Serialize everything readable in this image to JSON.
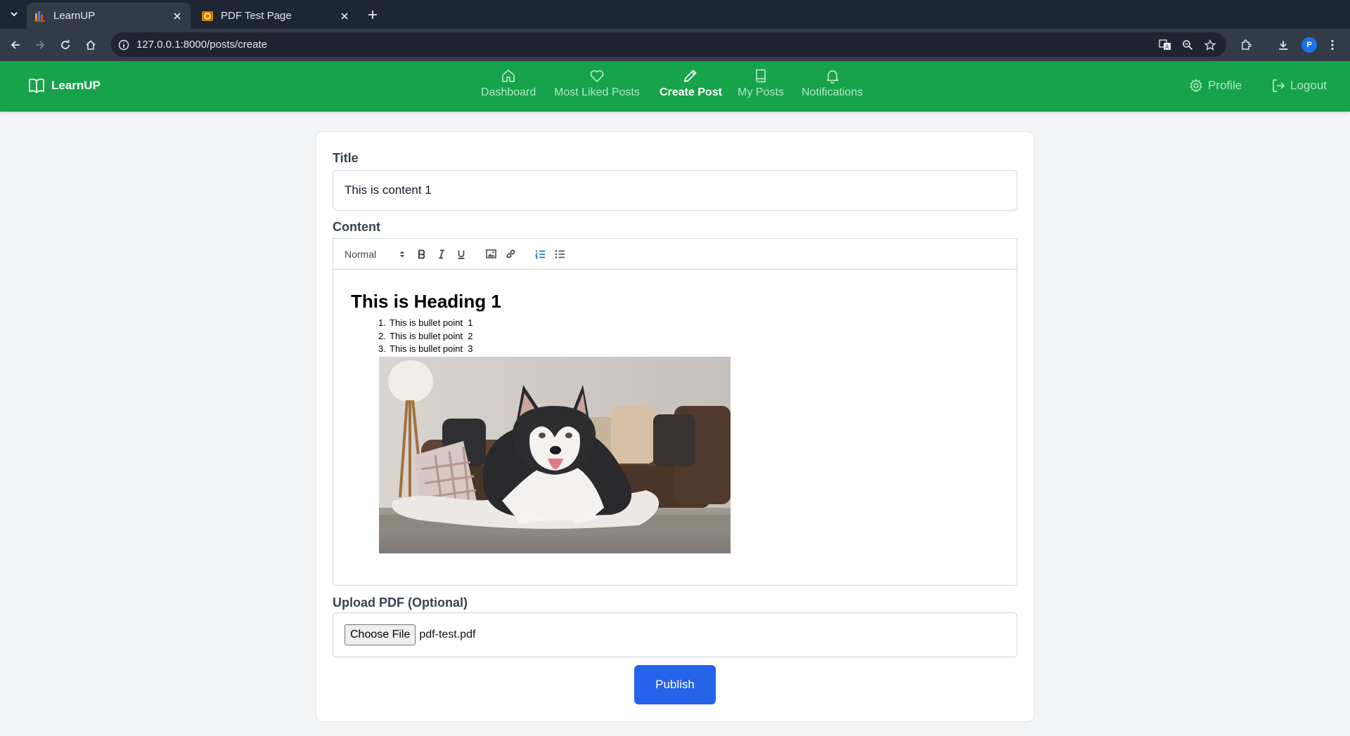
{
  "browser": {
    "tabs": [
      {
        "title": "LearnUP",
        "active": true
      },
      {
        "title": "PDF Test Page",
        "active": false
      }
    ],
    "url": "127.0.0.1:8000/posts/create",
    "profile_initial": "P"
  },
  "nav": {
    "brand": "LearnUP",
    "items": [
      {
        "label": "Dashboard",
        "icon": "home-icon"
      },
      {
        "label": "Most Liked Posts",
        "icon": "heart-icon"
      },
      {
        "label": "Create Post",
        "icon": "pencil-icon",
        "active": true
      },
      {
        "label": "My Posts",
        "icon": "book-icon"
      },
      {
        "label": "Notifications",
        "icon": "bell-icon"
      }
    ],
    "profile": "Profile",
    "logout": "Logout",
    "colors": {
      "bar": "#16a34a",
      "inactive": "#b3e6c6",
      "active": "#ffffff"
    }
  },
  "form": {
    "title_label": "Title",
    "title_value": "This is content 1",
    "content_label": "Content",
    "toolbar": {
      "header_picker": "Normal",
      "buttons": [
        "bold-icon",
        "italic-icon",
        "underline-icon",
        "image-icon",
        "link-icon",
        "ordered-list-icon",
        "bullet-list-icon"
      ]
    },
    "editor": {
      "heading": "This is Heading 1",
      "list": [
        {
          "num": "1.",
          "text": "This is bullet point  1"
        },
        {
          "num": "2.",
          "text": "This is bullet point  2"
        },
        {
          "num": "3.",
          "text": "This is bullet point  3"
        }
      ]
    },
    "pdf_label": "Upload PDF (Optional)",
    "choose_file": "Choose File",
    "file_name": "pdf-test.pdf",
    "publish": "Publish",
    "publish_color": "#2563eb"
  }
}
